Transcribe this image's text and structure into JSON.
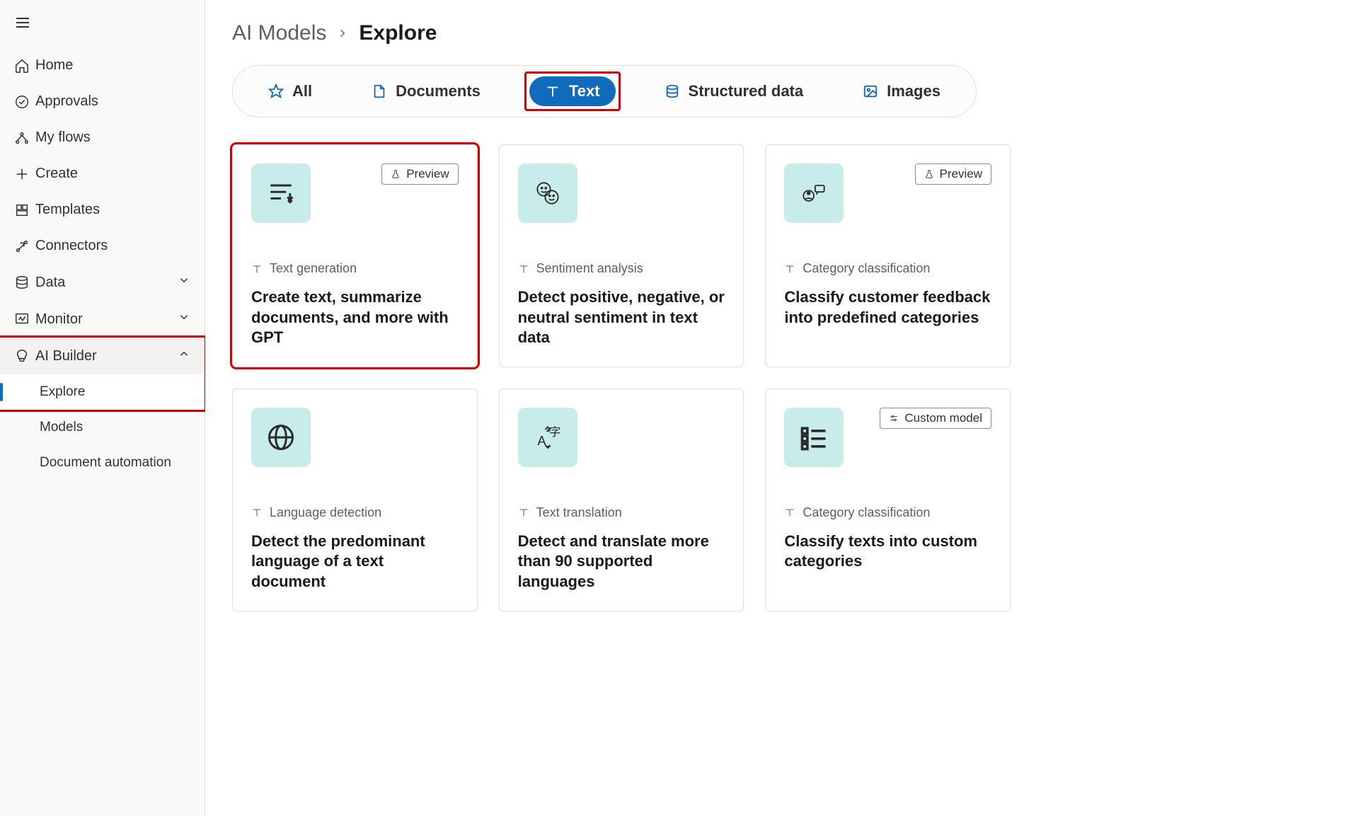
{
  "sidebar": {
    "items": [
      {
        "label": "Home"
      },
      {
        "label": "Approvals"
      },
      {
        "label": "My flows"
      },
      {
        "label": "Create"
      },
      {
        "label": "Templates"
      },
      {
        "label": "Connectors"
      },
      {
        "label": "Data"
      },
      {
        "label": "Monitor"
      },
      {
        "label": "AI Builder"
      }
    ],
    "sub": {
      "explore": "Explore",
      "models": "Models",
      "docauto": "Document automation"
    }
  },
  "breadcrumb": {
    "parent": "AI Models",
    "current": "Explore"
  },
  "filters": {
    "all": "All",
    "documents": "Documents",
    "text": "Text",
    "structured": "Structured data",
    "images": "Images"
  },
  "badges": {
    "preview": "Preview",
    "custom": "Custom model"
  },
  "cards": [
    {
      "category": "Text generation",
      "title": "Create text, summarize documents, and more with GPT"
    },
    {
      "category": "Sentiment analysis",
      "title": "Detect positive, negative, or neutral sentiment in text data"
    },
    {
      "category": "Category classification",
      "title": "Classify customer feedback into predefined categories"
    },
    {
      "category": "Language detection",
      "title": "Detect the predominant language of a text document"
    },
    {
      "category": "Text translation",
      "title": "Detect and translate more than 90 supported languages"
    },
    {
      "category": "Category classification",
      "title": "Classify texts into custom categories"
    }
  ]
}
